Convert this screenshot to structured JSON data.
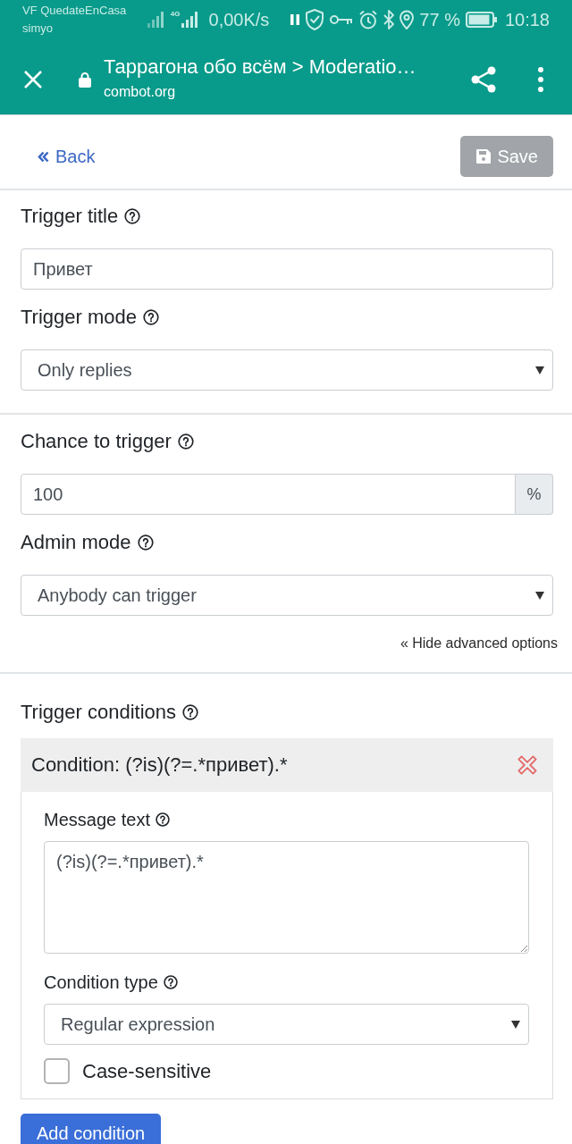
{
  "status_bar": {
    "carrier": "VF QuedateEnCasa",
    "carrier_secondary": "simyo",
    "network_type": "4G",
    "speed": "0,00K/s",
    "battery": "77 %",
    "time": "10:18"
  },
  "toolbar": {
    "title": "Таррагона обо всём > Moderatio…",
    "url": "combot.org"
  },
  "page_header": {
    "back_link": "Back",
    "save_button": {
      "label": "Save",
      "disabled": true
    }
  },
  "sections": [
    {
      "fields": [
        {
          "kind": "text",
          "label": "Trigger title",
          "value": "Привет"
        },
        {
          "kind": "select",
          "label": "Trigger mode",
          "value": "Only replies"
        }
      ]
    },
    {
      "fields": [
        {
          "kind": "addon",
          "label": "Chance to trigger",
          "value": "100",
          "addon": "%"
        },
        {
          "kind": "select",
          "label": "Admin mode",
          "value": "Anybody can trigger"
        }
      ],
      "options_link": "« Hide advanced options"
    }
  ],
  "conditions": {
    "label": "Trigger conditions",
    "items": [
      {
        "title": "Condition: (?is)(?=.*привет).*",
        "fields": [
          {
            "kind": "textarea",
            "label": "Message text",
            "value": "(?is)(?=.*привет).*"
          },
          {
            "kind": "select",
            "label": "Condition type",
            "value": "Regular expression"
          },
          {
            "kind": "checkbox",
            "label": "Case-sensitive",
            "checked": false
          }
        ]
      }
    ],
    "add_button": "Add condition"
  }
}
